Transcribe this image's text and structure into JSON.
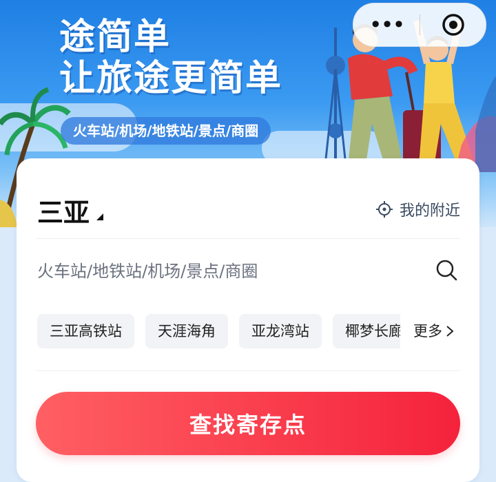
{
  "banner": {
    "title_line1": "途简单",
    "title_line2": "让旅途更简单",
    "tagline": "火车站/机场/地铁站/景点/商圈",
    "colors": {
      "sky_top": "#1f7fe4",
      "sky_bottom": "#cfe6fb"
    }
  },
  "capsule": {
    "more_glyph": "•••",
    "more_icon": "more-dots-icon",
    "close_icon": "target-close-icon"
  },
  "location": {
    "city": "三亚",
    "nearby_label": "我的附近",
    "nearby_icon": "locate-crosshair-icon"
  },
  "search": {
    "placeholder": "火车站/地铁站/机场/景点/商圈",
    "icon": "search-icon"
  },
  "quick_picks": [
    {
      "label": "三亚高铁站"
    },
    {
      "label": "天涯海角"
    },
    {
      "label": "亚龙湾站"
    },
    {
      "label": "椰梦长廊"
    }
  ],
  "more_label": "更多",
  "cta": {
    "label": "查找寄存点",
    "color_start": "#ff5f63",
    "color_end": "#f5223c"
  }
}
